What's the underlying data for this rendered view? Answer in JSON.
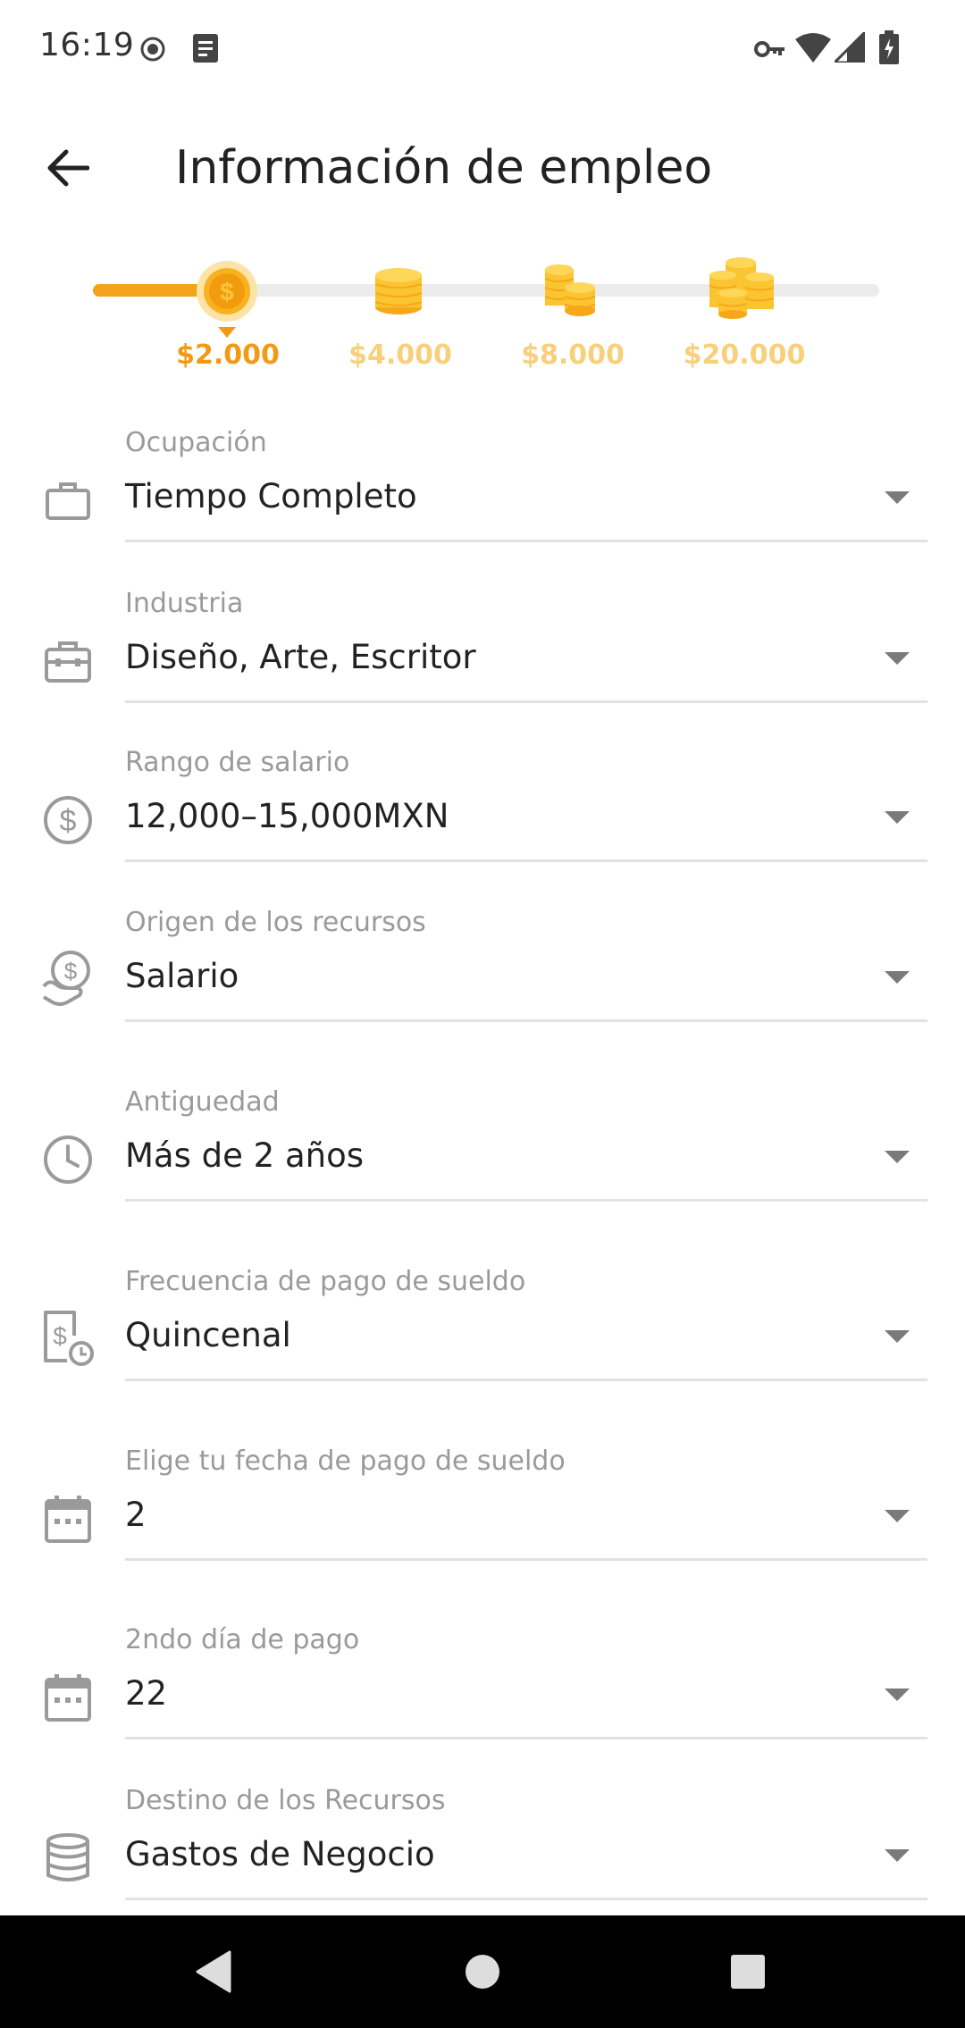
{
  "status_bar": {
    "time": "16:19"
  },
  "toolbar": {
    "title": "Información de empleo"
  },
  "levels": {
    "progress_fraction": 0.17,
    "active_index": 0,
    "items": [
      {
        "label": "$2.000"
      },
      {
        "label": "$4.000"
      },
      {
        "label": "$8.000"
      },
      {
        "label": "$20.000"
      }
    ]
  },
  "form": {
    "fields": [
      {
        "label": "Ocupación",
        "value": "Tiempo Completo",
        "icon": "briefcase-icon"
      },
      {
        "label": "Industria",
        "value": "Diseño, Arte, Escritor",
        "icon": "toolbox-icon"
      },
      {
        "label": "Rango de salario",
        "value": "12,000–15,000MXN",
        "icon": "dollar-circle-icon"
      },
      {
        "label": "Origen de los recursos",
        "value": "Salario",
        "icon": "hand-coin-icon"
      },
      {
        "label": "Antiguedad",
        "value": "Más de 2 años",
        "icon": "clock-icon"
      },
      {
        "label": "Frecuencia de pago de sueldo",
        "value": "Quincenal",
        "icon": "pay-schedule-icon"
      },
      {
        "label": "Elige tu fecha de pago de sueldo",
        "value": "2",
        "icon": "calendar-icon"
      },
      {
        "label": "2ndo día de pago",
        "value": "22",
        "icon": "calendar-icon"
      },
      {
        "label": "Destino de los Recursos",
        "value": "Gastos de Negocio",
        "icon": "database-icon"
      }
    ]
  },
  "colors": {
    "accent": "#f39a15",
    "accent_light": "#f8cf7a",
    "coin": "#fbc531"
  }
}
